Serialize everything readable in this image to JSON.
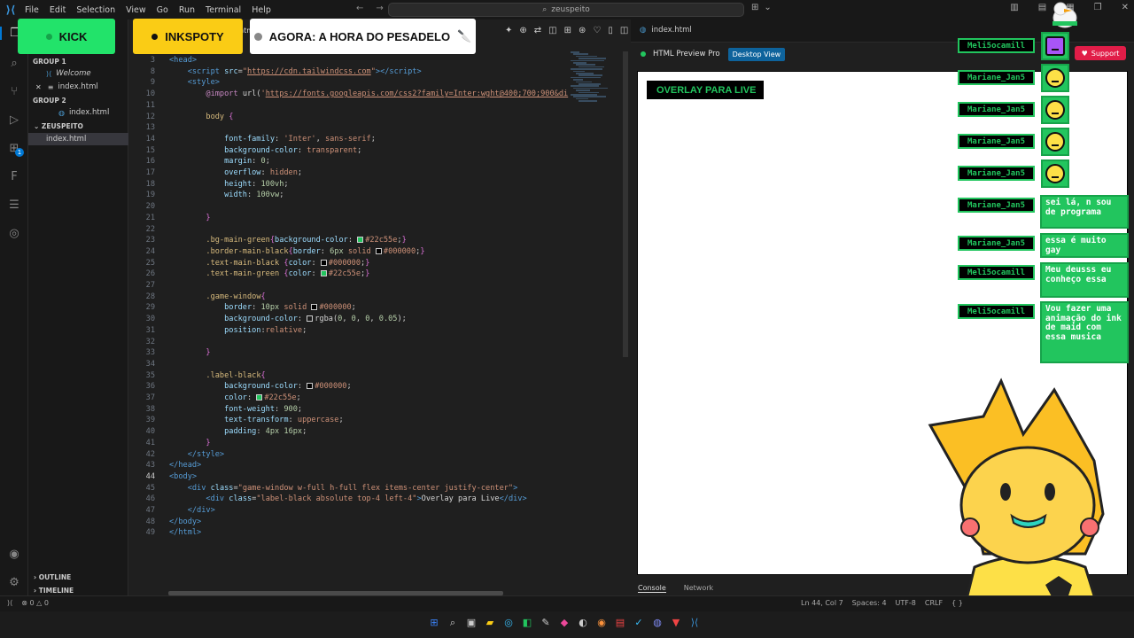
{
  "titlebar": {
    "menu": [
      "File",
      "Edit",
      "Selection",
      "View",
      "Go",
      "Run",
      "Terminal",
      "Help"
    ],
    "search": "zeuspeito"
  },
  "badges": {
    "kick": "KICK",
    "inkspot": "INKSPOTY",
    "now_playing": "AGORA: A HORA DO PESADELO"
  },
  "sidebar": {
    "group1": "GROUP 1",
    "group1_items": [
      "Welcome",
      "index.html"
    ],
    "group2": "GROUP 2",
    "group2_items": [
      "index.html"
    ],
    "folder": "ZEUSPEITO",
    "folder_items": [
      "index.html"
    ],
    "outline": "OUTLINE",
    "timeline": "TIMELINE"
  },
  "editor": {
    "tab_label": "ex.htm",
    "current_line": 44,
    "lines": [
      {
        "n": 3,
        "html": "<span class='t-tag'>&lt;head&gt;</span>"
      },
      {
        "n": 8,
        "html": "    <span class='t-tag'>&lt;script</span> <span class='t-attr'>src</span>=<span class='t-str'>\"<span class='t-link'>https://cdn.tailwindcss.com</span>\"</span><span class='t-tag'>&gt;&lt;/script&gt;</span>"
      },
      {
        "n": 9,
        "html": "    <span class='t-tag'>&lt;style&gt;</span>"
      },
      {
        "n": 10,
        "html": "        <span class='t-at'>@import</span> <span class='t-plain'>url(</span><span class='t-str'>'<span class='t-link'>https://fonts.googleapis.com/css2?family=Inter:wght@400;700;900&amp;di</span></span>"
      },
      {
        "n": 11,
        "html": ""
      },
      {
        "n": 12,
        "html": "        <span class='t-sel'>body</span> <span class='t-brace'>{</span>"
      },
      {
        "n": 13,
        "html": ""
      },
      {
        "n": 14,
        "html": "            <span class='t-prop'>font-family</span>: <span class='t-val'>'Inter'</span>, <span class='t-val'>sans-serif</span>;"
      },
      {
        "n": 15,
        "html": "            <span class='t-prop'>background-color</span>: <span class='t-val'>transparent</span>;"
      },
      {
        "n": 16,
        "html": "            <span class='t-prop'>margin</span>: <span class='t-num'>0</span>;"
      },
      {
        "n": 17,
        "html": "            <span class='t-prop'>overflow</span>: <span class='t-val'>hidden</span>;"
      },
      {
        "n": 18,
        "html": "            <span class='t-prop'>height</span>: <span class='t-num'>100vh</span>;"
      },
      {
        "n": 19,
        "html": "            <span class='t-prop'>width</span>: <span class='t-num'>100vw</span>;"
      },
      {
        "n": 20,
        "html": ""
      },
      {
        "n": 21,
        "html": "        <span class='t-brace'>}</span>"
      },
      {
        "n": 22,
        "html": ""
      },
      {
        "n": 23,
        "html": "        <span class='t-sel'>.bg-main-green</span><span class='t-brace'>{</span><span class='t-prop'>background-color</span>: <i class='sw' style='background:#22c55e'></i><span class='t-val'>#22c55e</span>;<span class='t-brace'>}</span>"
      },
      {
        "n": 24,
        "html": "        <span class='t-sel'>.border-main-black</span><span class='t-brace'>{</span><span class='t-prop'>border</span>: <span class='t-num'>6px</span> <span class='t-val'>solid</span> <i class='sw' style='background:#000'></i><span class='t-val'>#000000</span>;<span class='t-brace'>}</span>"
      },
      {
        "n": 25,
        "html": "        <span class='t-sel'>.text-main-black</span> <span class='t-brace'>{</span><span class='t-prop'>color</span>: <i class='sw' style='background:#000'></i><span class='t-val'>#000000</span>;<span class='t-brace'>}</span>"
      },
      {
        "n": 26,
        "html": "        <span class='t-sel'>.text-main-green</span> <span class='t-brace'>{</span><span class='t-prop'>color</span>: <i class='sw' style='background:#22c55e'></i><span class='t-val'>#22c55e</span>;<span class='t-brace'>}</span>"
      },
      {
        "n": 27,
        "html": ""
      },
      {
        "n": 28,
        "html": "        <span class='t-sel'>.game-window</span><span class='t-brace'>{</span>"
      },
      {
        "n": 29,
        "html": "            <span class='t-prop'>border</span>: <span class='t-num'>10px</span> <span class='t-val'>solid</span> <i class='sw' style='background:#000'></i><span class='t-val'>#000000</span>;"
      },
      {
        "n": 30,
        "html": "            <span class='t-prop'>background-color</span>: <i class='sw' style='background:rgba(0,0,0,0.05)'></i><span class='t-plain'>rgba(</span><span class='t-num'>0</span>, <span class='t-num'>0</span>, <span class='t-num'>0</span>, <span class='t-num'>0.05</span><span class='t-plain'>)</span>;"
      },
      {
        "n": 31,
        "html": "            <span class='t-prop'>position</span>:<span class='t-val'>relative</span>;"
      },
      {
        "n": 32,
        "html": ""
      },
      {
        "n": 33,
        "html": "        <span class='t-brace'>}</span>"
      },
      {
        "n": 34,
        "html": ""
      },
      {
        "n": 35,
        "html": "        <span class='t-sel'>.label-black</span><span class='t-brace'>{</span>"
      },
      {
        "n": 36,
        "html": "            <span class='t-prop'>background-color</span>: <i class='sw' style='background:#000'></i><span class='t-val'>#000000</span>;"
      },
      {
        "n": 37,
        "html": "            <span class='t-prop'>color</span>: <i class='sw' style='background:#22c55e'></i><span class='t-val'>#22c55e</span>;"
      },
      {
        "n": 38,
        "html": "            <span class='t-prop'>font-weight</span>: <span class='t-num'>900</span>;"
      },
      {
        "n": 39,
        "html": "            <span class='t-prop'>text-transform</span>: <span class='t-val'>uppercase</span>;"
      },
      {
        "n": 40,
        "html": "            <span class='t-prop'>padding</span>: <span class='t-num'>4px</span> <span class='t-num'>16px</span>;"
      },
      {
        "n": 41,
        "html": "        <span class='t-brace'>}</span>"
      },
      {
        "n": 42,
        "html": "    <span class='t-tag'>&lt;/style&gt;</span>"
      },
      {
        "n": 43,
        "html": "<span class='t-tag'>&lt;/head&gt;</span>"
      },
      {
        "n": 44,
        "html": "<span class='t-tag'>&lt;body&gt;</span>"
      },
      {
        "n": 45,
        "html": "    <span class='t-tag'>&lt;div</span> <span class='t-attr'>class</span>=<span class='t-str'>\"game-window w-full h-full flex items-center justify-center\"</span><span class='t-tag'>&gt;</span>"
      },
      {
        "n": 46,
        "html": "        <span class='t-tag'>&lt;div</span> <span class='t-attr'>class</span>=<span class='t-str'>\"label-black absolute top-4 left-4\"</span><span class='t-tag'>&gt;</span><span class='t-plain'>Overlay para Live</span><span class='t-tag'>&lt;/div&gt;</span>"
      },
      {
        "n": 47,
        "html": "    <span class='t-tag'>&lt;/div&gt;</span>"
      },
      {
        "n": 48,
        "html": "<span class='t-tag'>&lt;/body&gt;</span>"
      },
      {
        "n": 49,
        "html": "<span class='t-tag'>&lt;/html&gt;</span>"
      }
    ]
  },
  "preview": {
    "tab": "index.html",
    "toolbar_name": "HTML Preview Pro",
    "desktop_btn": "Desktop View",
    "overlay_label": "OVERLAY PARA LIVE",
    "console_tab": "Console",
    "network_tab": "Network"
  },
  "support": "Support",
  "chat": [
    {
      "user": "Meli5ocamill",
      "type": "sticker"
    },
    {
      "user": "Mariane_Jan5",
      "type": "avatar"
    },
    {
      "user": "Mariane_Jan5",
      "type": "avatar"
    },
    {
      "user": "Mariane_Jan5",
      "type": "avatar"
    },
    {
      "user": "Mariane_Jan5",
      "type": "avatar"
    },
    {
      "user": "Mariane_Jan5",
      "type": "text",
      "text": "sei lá, n sou de programa"
    },
    {
      "user": "Mariane_Jan5",
      "type": "text",
      "text": "essa é muito gay"
    },
    {
      "user": "Meli5ocamill",
      "type": "text",
      "text": "Meu deusss eu conheço essa"
    },
    {
      "user": "Meli5ocamill",
      "type": "text",
      "text": "Vou fazer uma animação do ink de maid com essa musica"
    }
  ],
  "statusbar": {
    "errors": "0",
    "warnings": "0",
    "position": "Ln 44, Col 7",
    "spaces": "Spaces: 4",
    "encoding": "UTF-8",
    "eol": "CRLF"
  }
}
